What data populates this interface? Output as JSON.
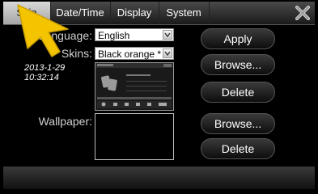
{
  "tabs": [
    {
      "label": "Skin",
      "active": true
    },
    {
      "label": "Date/Time",
      "active": false
    },
    {
      "label": "Display",
      "active": false
    },
    {
      "label": "System",
      "active": false
    }
  ],
  "labels": {
    "language": "Language:",
    "skins": "Skins:",
    "wallpaper": "Wallpaper:"
  },
  "clock": {
    "date": "2013-1-29",
    "time": "10:32:14"
  },
  "selects": {
    "language_value": "English",
    "skins_value": "Black orange *"
  },
  "buttons": {
    "apply": "Apply",
    "browse_skin": "Browse...",
    "delete_skin": "Delete",
    "browse_wallpaper": "Browse...",
    "delete_wallpaper": "Delete"
  },
  "icons": {
    "close": "close-icon",
    "pointer": "pointer-arrow-icon",
    "dropdown": "chevron-down-icon"
  },
  "colors": {
    "pointer": "#f5c400",
    "active_tab": "#c0c0c0"
  }
}
